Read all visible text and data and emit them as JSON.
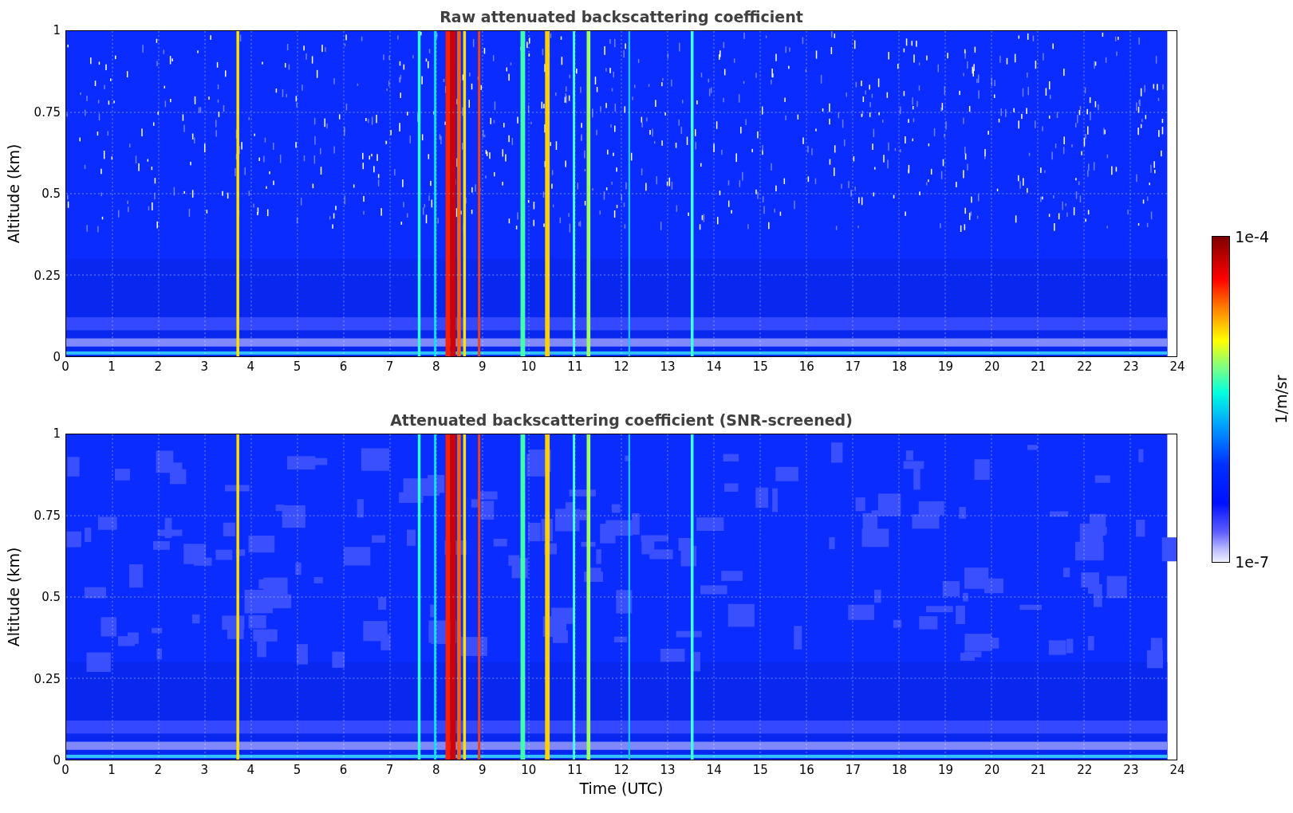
{
  "panels": [
    {
      "kind": "raw",
      "title": "Raw attenuated backscattering coefficient",
      "ylabel": "Altitude (km)",
      "yticks": [
        "1",
        "0.75",
        "0.5",
        "0.25",
        "0"
      ],
      "xticks": [
        "0",
        "1",
        "2",
        "3",
        "4",
        "5",
        "6",
        "7",
        "8",
        "9",
        "10",
        "11",
        "12",
        "13",
        "14",
        "15",
        "16",
        "17",
        "18",
        "19",
        "20",
        "21",
        "22",
        "23",
        "24"
      ]
    },
    {
      "kind": "screened",
      "title": "Attenuated backscattering coefficient (SNR-screened)",
      "ylabel": "Altitude (km)",
      "yticks": [
        "1",
        "0.75",
        "0.5",
        "0.25",
        "0"
      ],
      "xticks": [
        "0",
        "1",
        "2",
        "3",
        "4",
        "5",
        "6",
        "7",
        "8",
        "9",
        "10",
        "11",
        "12",
        "13",
        "14",
        "15",
        "16",
        "17",
        "18",
        "19",
        "20",
        "21",
        "22",
        "23",
        "24"
      ],
      "xlabel": "Time (UTC)"
    }
  ],
  "colorbar": {
    "max_label": "1e-4",
    "min_label": "1e-7",
    "label": "1/m/sr"
  }
}
